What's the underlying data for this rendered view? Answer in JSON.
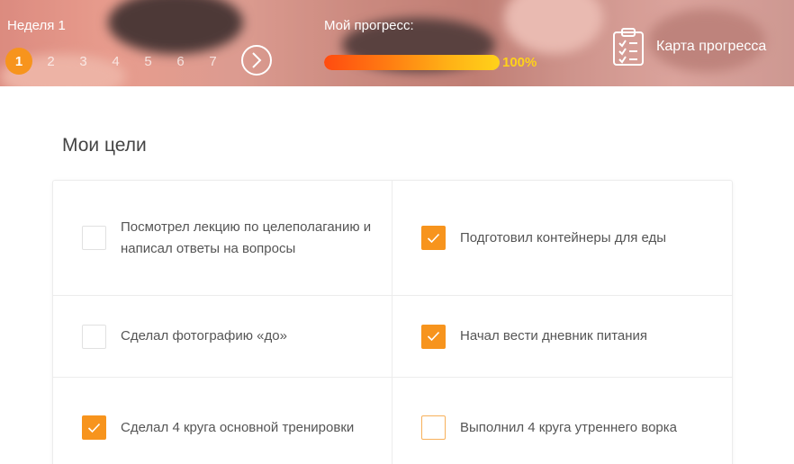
{
  "header": {
    "week_title": "Неделя 1",
    "week_steps": [
      "1",
      "2",
      "3",
      "4",
      "5",
      "6",
      "7"
    ],
    "active_week": "1",
    "progress_label": "Мой прогресс:",
    "progress_value": "100%",
    "progress_fraction": 1.0,
    "map_label": "Карта прогресса",
    "icons": {
      "next": "chevron-right-icon",
      "map": "clipboard-checklist-icon"
    },
    "colors": {
      "accent": "#f7941d",
      "progress_start": "#ff4b10",
      "progress_end": "#ffd21a"
    }
  },
  "goals": {
    "title": "Мои цели",
    "items": [
      {
        "text": "Посмотрел лекцию по целеполаганию и написал ответы на вопросы",
        "checked": false
      },
      {
        "text": "Подготовил контейнеры для еды",
        "checked": true
      },
      {
        "text": "Сделал фотографию «до»",
        "checked": false
      },
      {
        "text": "Начал вести дневник питания",
        "checked": true
      },
      {
        "text": "Сделал 4 круга основной тренировки",
        "checked": true
      },
      {
        "text": "Выполнил 4 круга утреннего ворка",
        "checked": false
      }
    ]
  }
}
